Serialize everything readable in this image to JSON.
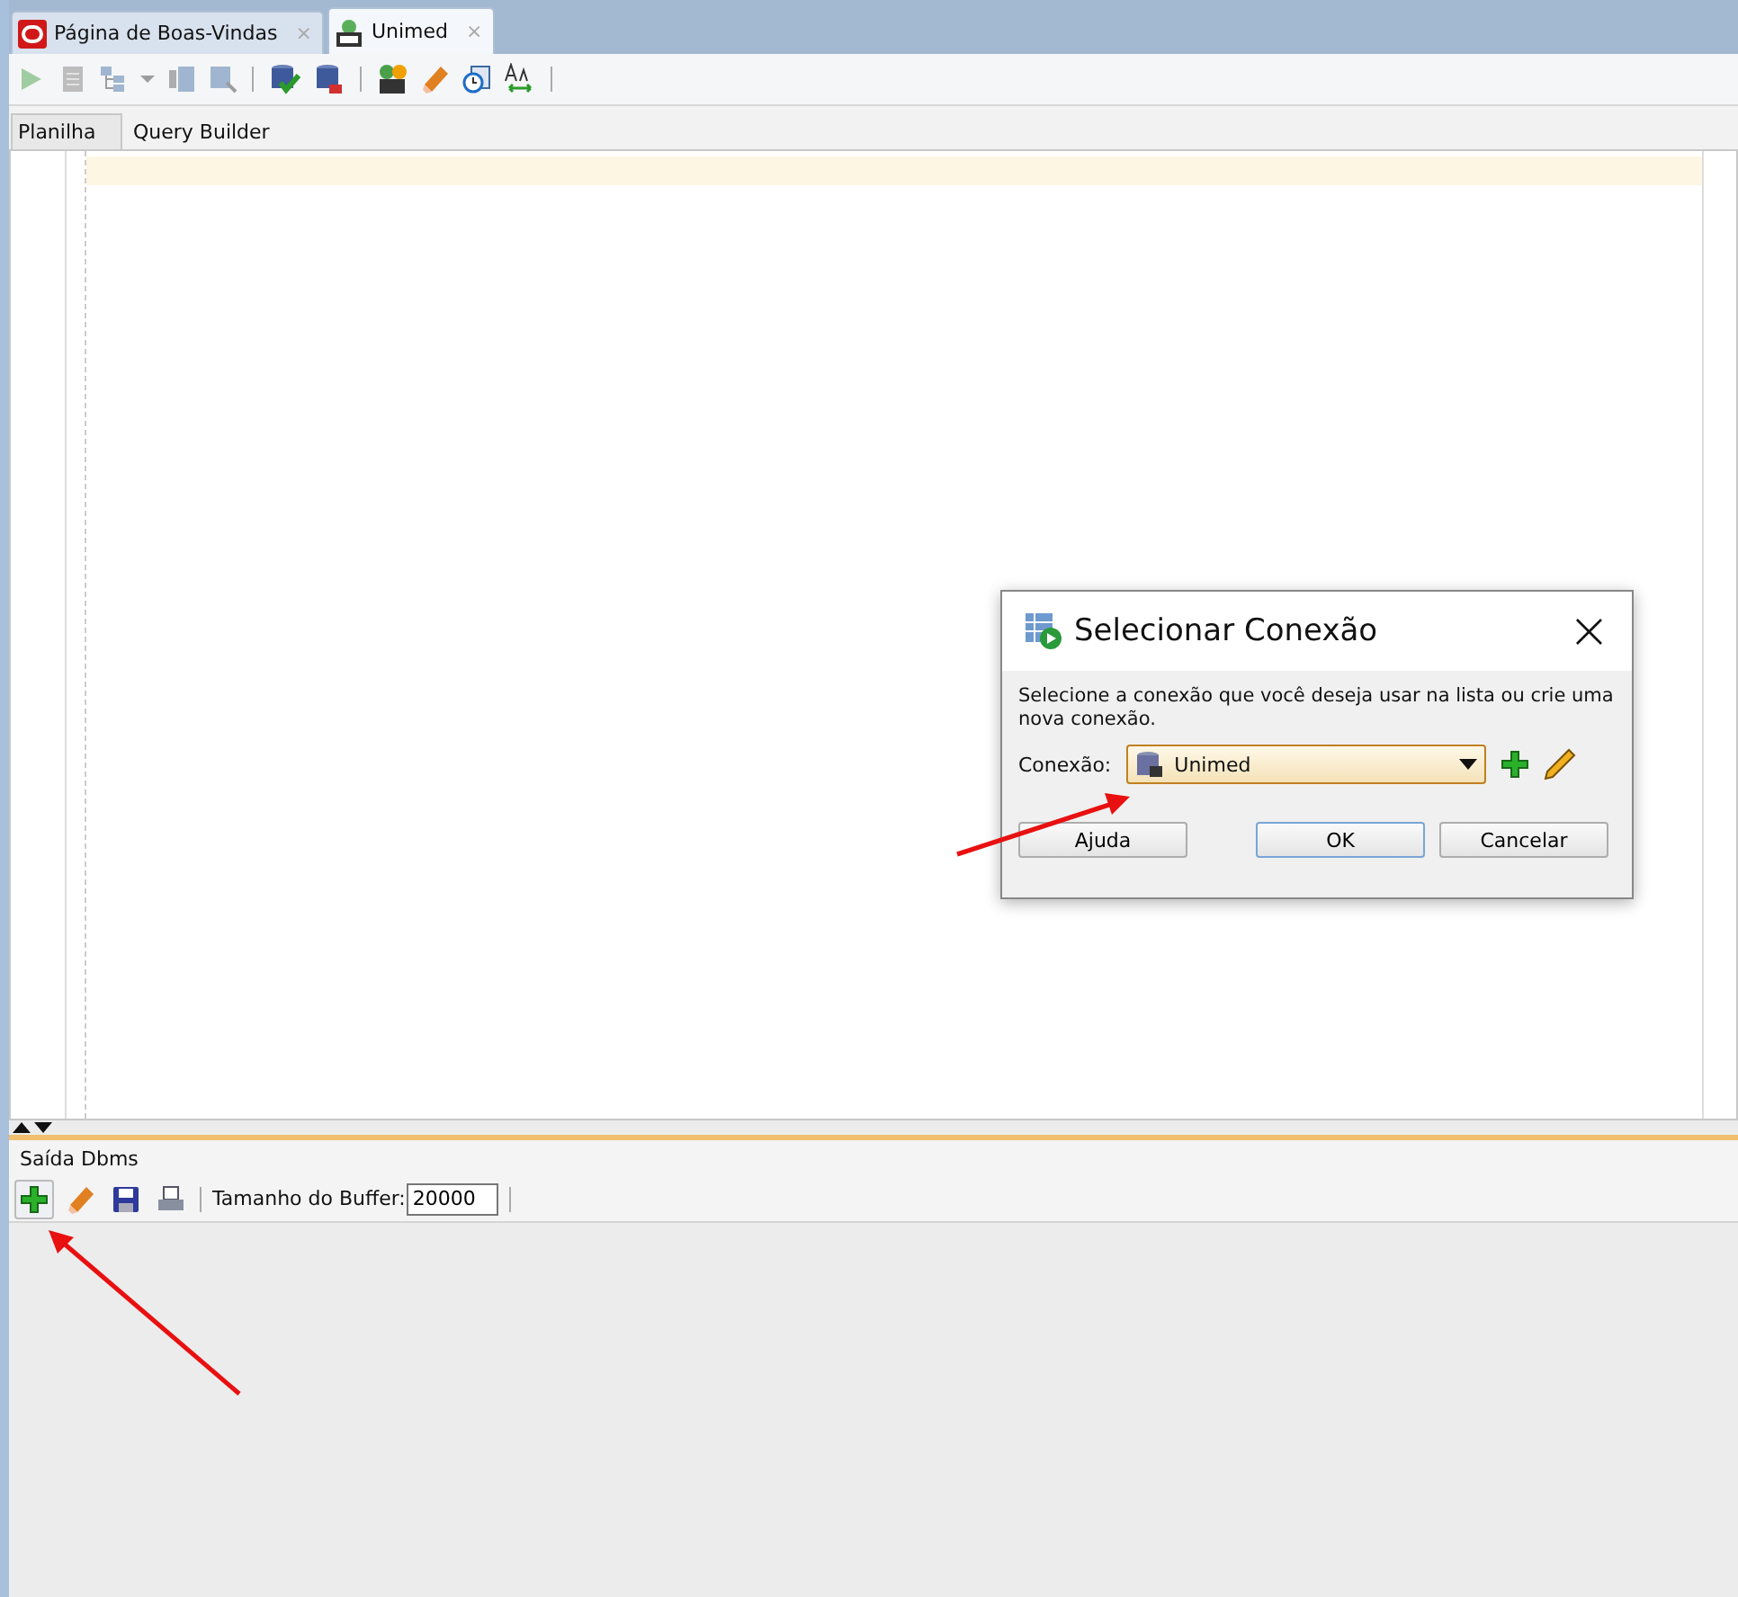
{
  "document_tabs": [
    {
      "label": "Página de Boas-Vindas",
      "kind": "welcome",
      "selected": false,
      "close": "×"
    },
    {
      "label": "Unimed",
      "kind": "sql",
      "selected": true,
      "close": "×"
    }
  ],
  "toolbar": {
    "buttons": [
      {
        "kind": "run",
        "disabled": true
      },
      {
        "kind": "script",
        "disabled": true
      },
      {
        "kind": "plan",
        "disabled": true
      },
      {
        "kind": "dropdown",
        "disabled": true
      },
      {
        "kind": "autotrace",
        "disabled": true
      },
      {
        "kind": "find",
        "disabled": true
      },
      {
        "kind": "sep"
      },
      {
        "kind": "commit",
        "disabled": false
      },
      {
        "kind": "rollback",
        "disabled": false
      },
      {
        "kind": "sep"
      },
      {
        "kind": "tuning",
        "disabled": false
      },
      {
        "kind": "eraser",
        "disabled": false
      },
      {
        "kind": "history",
        "disabled": false
      },
      {
        "kind": "format",
        "disabled": false
      },
      {
        "kind": "sep"
      }
    ]
  },
  "editor_tabs": [
    {
      "label": "Planilha",
      "selected": true
    },
    {
      "label": "Query Builder",
      "selected": false
    }
  ],
  "output_panel": {
    "title": "Saída Dbms",
    "toolbar": [
      {
        "kind": "add"
      },
      {
        "kind": "eraser"
      },
      {
        "kind": "save"
      },
      {
        "kind": "print"
      }
    ],
    "buffer_label": "Tamanho do Buffer:",
    "buffer_value": "20000"
  },
  "dialog": {
    "title": "Selecionar Conexão",
    "close": "×",
    "message": "Selecione a conexão que você deseja usar na lista ou crie uma nova conexão.",
    "connection_label": "Conexão:",
    "connection_value": "Unimed",
    "buttons": [
      {
        "label": "Ajuda",
        "default": false
      },
      {
        "label": "OK",
        "default": true
      },
      {
        "label": "Cancelar",
        "default": false
      }
    ]
  }
}
